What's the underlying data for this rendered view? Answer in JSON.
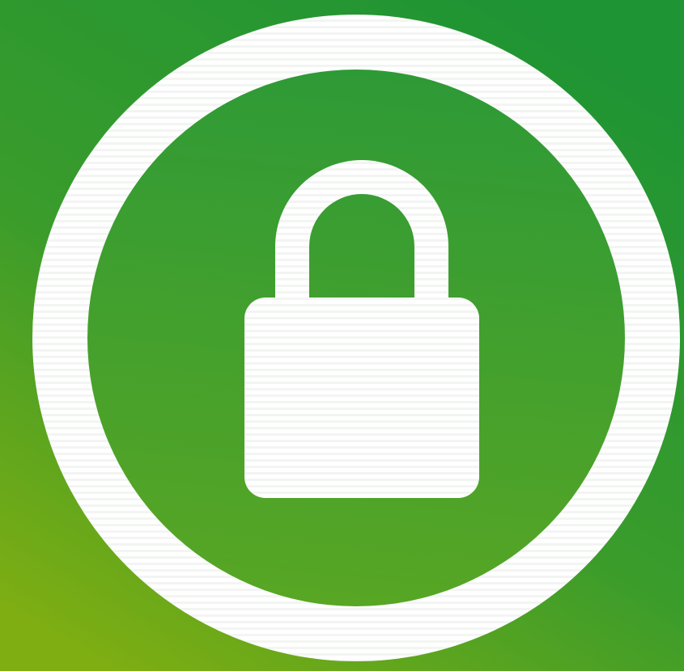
{
  "image": {
    "subject": "padlock-icon",
    "colors": {
      "background_top": "#1f9434",
      "background_mid": "#3a9c2b",
      "background_bottom": "#7fae12",
      "inner_disc": "#2e9a36",
      "inner_disc_bottom": "#58a624",
      "ring": "#ffffff",
      "lock": "#ffffff",
      "scanlines": "#e8ece8"
    }
  }
}
